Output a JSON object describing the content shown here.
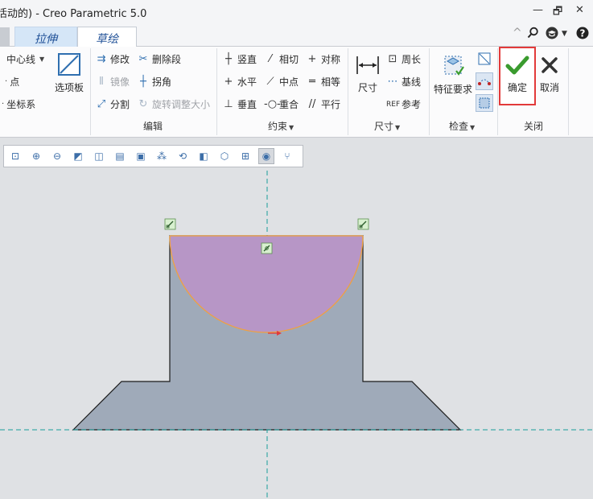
{
  "window": {
    "title": "活动的) - Creo Parametric 5.0",
    "controls": {
      "minimize": "—",
      "restore": "🗗",
      "close": "✕"
    }
  },
  "tabs": [
    {
      "label": "拉伸"
    },
    {
      "label": "草绘"
    }
  ],
  "ribbon": {
    "datum": {
      "centerline": "中心线",
      "point": "点",
      "coordsys": "坐标系",
      "palette": "选项板"
    },
    "edit": {
      "label": "编辑",
      "modify": "修改",
      "delete_segment": "删除段",
      "mirror": "镜像",
      "corner": "拐角",
      "divide": "分割",
      "rotate_resize": "旋转调整大小"
    },
    "constrain": {
      "label": "约束",
      "vertical": "竖直",
      "tangent": "相切",
      "symmetric": "对称",
      "horizontal": "水平",
      "midpoint": "中点",
      "equal": "相等",
      "perpendicular": "垂直",
      "coincident": "重合",
      "parallel": "平行"
    },
    "dimension": {
      "label": "尺寸",
      "normal": "尺寸",
      "perimeter": "周长",
      "baseline": "基线",
      "reference": "参考"
    },
    "inspect": {
      "label": "检查",
      "feature_req": "特征要求"
    },
    "close": {
      "label": "关闭",
      "ok": "确定",
      "cancel": "取消"
    }
  },
  "colors": {
    "accent_blue": "#1e4f96",
    "ok_green": "#3a9b2e",
    "highlight_red": "#e23a3a",
    "section_fill": "#9faab9",
    "semicircle_fill": "#b796c6",
    "centerline": "#1a9d9a"
  }
}
